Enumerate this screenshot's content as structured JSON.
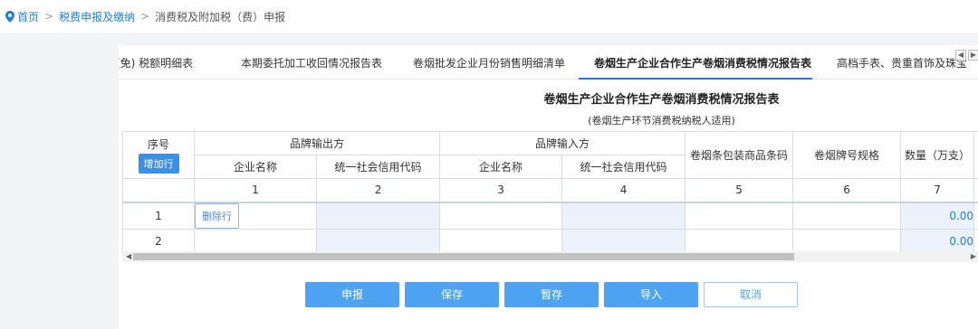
{
  "breadcrumb": {
    "home": "首页",
    "level1": "税费申报及缴纳",
    "current": "消费税及附加税（费）申报",
    "separator": ">"
  },
  "tabs": [
    {
      "label": "(免) 税额明细表"
    },
    {
      "label": "本期委托加工收回情况报告表"
    },
    {
      "label": "卷烟批发企业月份销售明细清单"
    },
    {
      "label": "卷烟生产企业合作生产卷烟消费税情况报告表",
      "active": true
    },
    {
      "label": "高档手表、贵重首饰及珠宝"
    }
  ],
  "tab_scroll": {
    "left": "◀",
    "right": "▶"
  },
  "report": {
    "title": "卷烟生产企业合作生产卷烟消费税情况报告表",
    "subtitle": "(卷烟生产环节消费税纳税人适用)"
  },
  "table": {
    "seq_header": "序号",
    "add_row_label": "增加行",
    "group_output": "品牌输出方",
    "group_input": "品牌输入方",
    "company_name": "企业名称",
    "credit_code": "统一社会信用代码",
    "barcode": "卷烟条包装商品条码",
    "brand_spec": "卷烟牌号规格",
    "quantity": "数量（万支）",
    "col_numbers": [
      "1",
      "2",
      "3",
      "4",
      "5",
      "6",
      "7"
    ],
    "rows": [
      {
        "seq": "1",
        "delete_label": "删除行",
        "quantity": "0.00"
      },
      {
        "seq": "2",
        "quantity": "0.00"
      }
    ]
  },
  "scrollbar": {
    "left": "◀",
    "right": "▶"
  },
  "actions": {
    "declare": "申报",
    "save": "保存",
    "temp_save": "暂存",
    "import": "导入",
    "cancel": "取消"
  },
  "colors": {
    "accent": "#1e7fe0",
    "button": "#4da3f0",
    "cell_highlight": "#ecf2fc"
  }
}
